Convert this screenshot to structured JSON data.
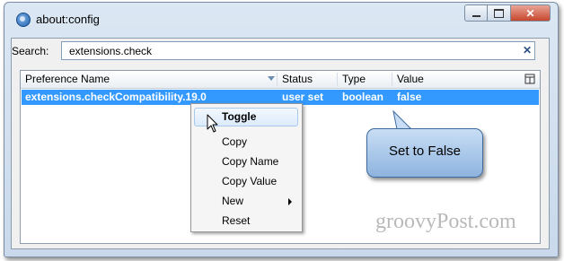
{
  "window": {
    "title": "about:config",
    "buttons": {
      "minimize": "minimize",
      "maximize": "maximize",
      "close": "✕"
    }
  },
  "search": {
    "label": "Search:",
    "value": "extensions.check",
    "clear": "✕"
  },
  "table": {
    "headers": [
      "Preference Name",
      "Status",
      "Type",
      "Value"
    ],
    "rows": [
      {
        "name": "extensions.checkCompatibility.19.0",
        "status": "user set",
        "type": "boolean",
        "value": "false",
        "selected": true
      }
    ]
  },
  "context_menu": {
    "items": [
      "Toggle",
      "Copy",
      "Copy Name",
      "Copy Value",
      "New",
      "Reset"
    ],
    "highlighted": "Toggle"
  },
  "callout": {
    "text": "Set to False"
  },
  "watermark": "groovyPost.com",
  "colors": {
    "selection": "#3399ff",
    "callout_fill": "#a9c8ea",
    "callout_border": "#3e6aa0",
    "close_button": "#c7472e"
  },
  "icons": [
    "app-icon",
    "sort-arrow-icon",
    "column-picker-icon",
    "clear-search-icon",
    "submenu-arrow-icon",
    "mouse-cursor-icon"
  ]
}
